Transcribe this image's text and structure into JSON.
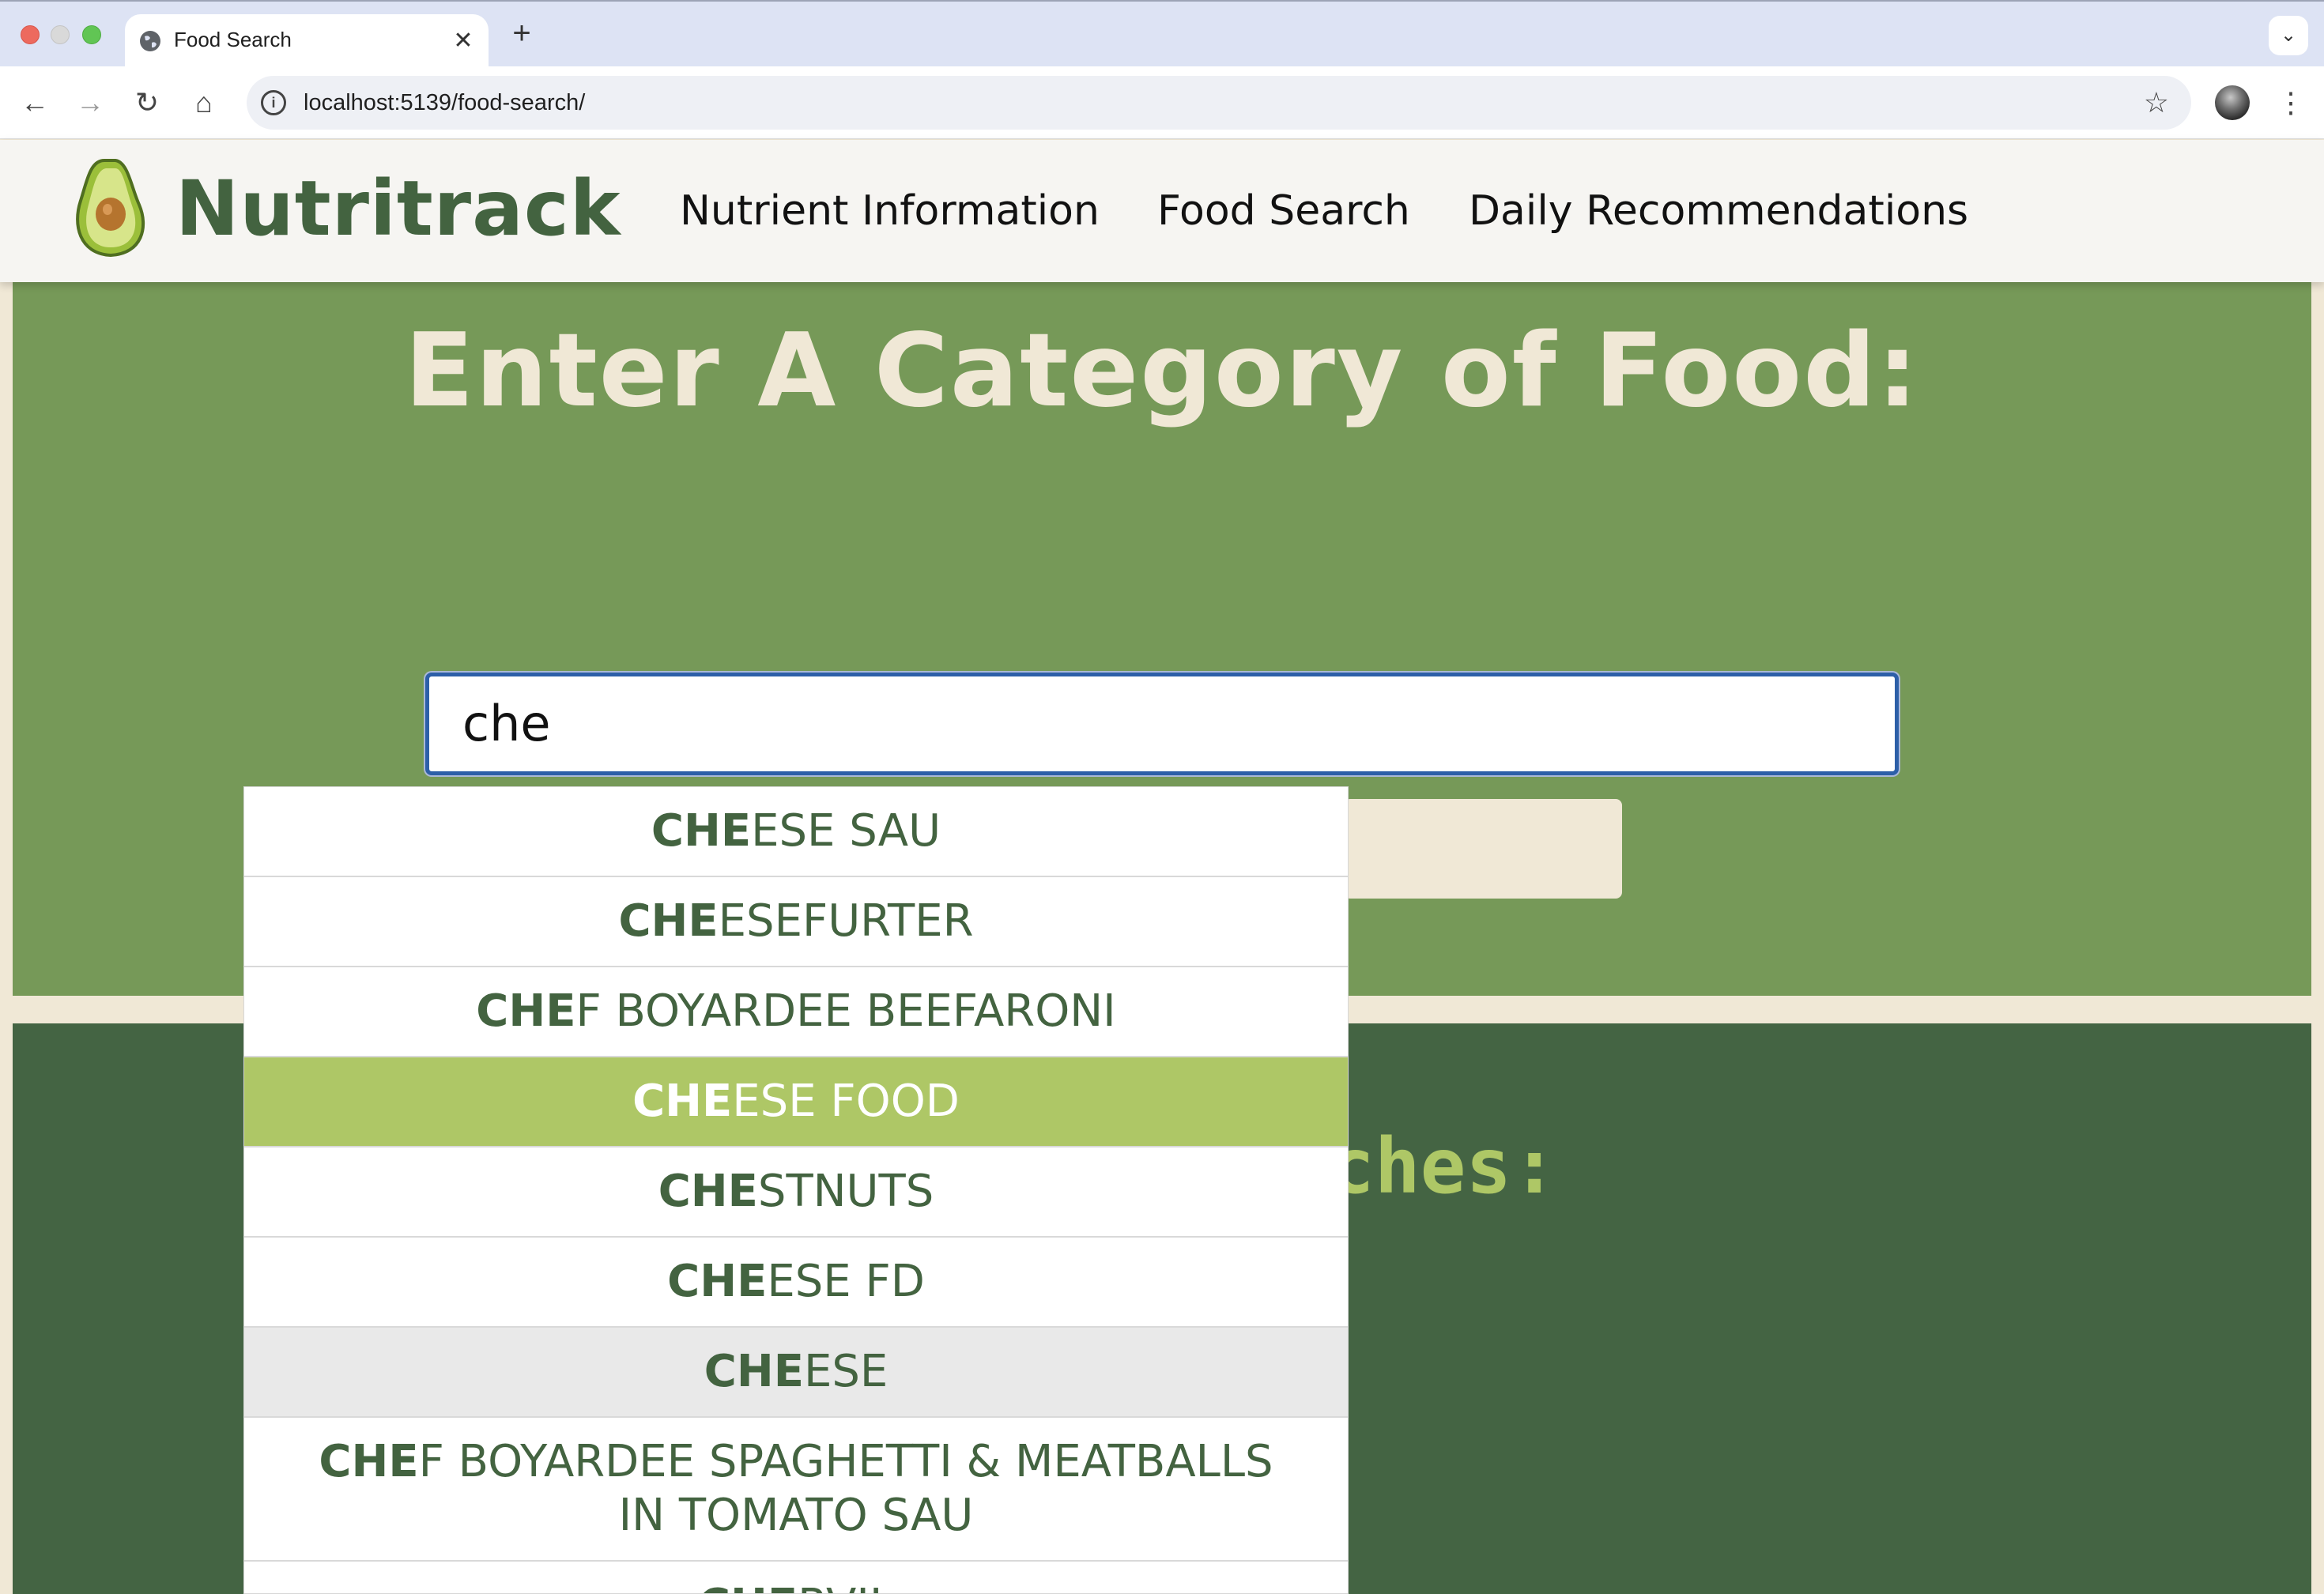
{
  "browser": {
    "tab_title": "Food Search",
    "tab_icon": "globe-icon",
    "url": "localhost:5139/food-search/",
    "new_tab_symbol": "+",
    "close_symbol": "✕"
  },
  "site": {
    "logo_text": "Nutritrack",
    "nav": [
      {
        "label": "Nutrient Information"
      },
      {
        "label": "Food Search"
      },
      {
        "label": "Daily Recommendations"
      }
    ]
  },
  "search": {
    "heading": "Enter A Category of Food:",
    "input_value": "che",
    "button_label": ""
  },
  "recent": {
    "heading_visible_part": "rches:"
  },
  "autocomplete": {
    "items": [
      {
        "match": "CHE",
        "rest": "ESE SAU",
        "state": "normal"
      },
      {
        "match": "CHE",
        "rest": "ESEFURTER",
        "state": "normal"
      },
      {
        "match": "CHE",
        "rest": "F BOYARDEE BEEFARONI",
        "state": "normal"
      },
      {
        "match": "CHE",
        "rest": "ESE FOOD",
        "state": "active"
      },
      {
        "match": "CHE",
        "rest": "STNUTS",
        "state": "normal"
      },
      {
        "match": "CHE",
        "rest": "ESE FD",
        "state": "normal"
      },
      {
        "match": "CHE",
        "rest": "ESE",
        "state": "hover"
      },
      {
        "match": "CHE",
        "rest": "F BOYARDEE SPAGHETTI & MEATBALLS IN TOMATO SAU",
        "state": "normal"
      },
      {
        "match": "CHE",
        "rest": "RVIL",
        "state": "normal"
      }
    ]
  },
  "colors": {
    "brand_dark_green": "#436340",
    "search_bg_green": "#769958",
    "accent_lime": "#aec766",
    "cream": "#f0e8d6"
  }
}
